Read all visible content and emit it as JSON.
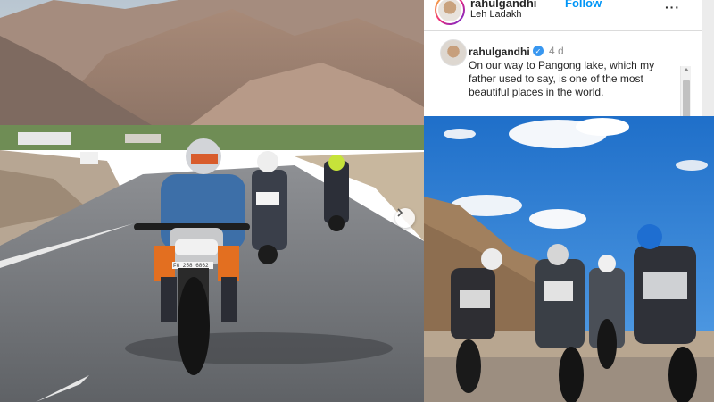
{
  "post": {
    "username": "rahulgandhi",
    "follow_label": "Follow",
    "location": "Leh Ladakh",
    "more_label": "···",
    "caption_username": "rahulgandhi",
    "verified_mark": "✓",
    "time_ago": "4 d",
    "caption": "On our way to Pangong lake, which my father used to say, is one of the most beautiful places in the world."
  },
  "left_photo": {
    "front_plate": "FG 258 6862",
    "next_icon": "chevron-right-icon"
  },
  "colors": {
    "follow_blue": "#0095f6",
    "verified_blue": "#3897f0",
    "sky_blue": "#3b86d6"
  }
}
